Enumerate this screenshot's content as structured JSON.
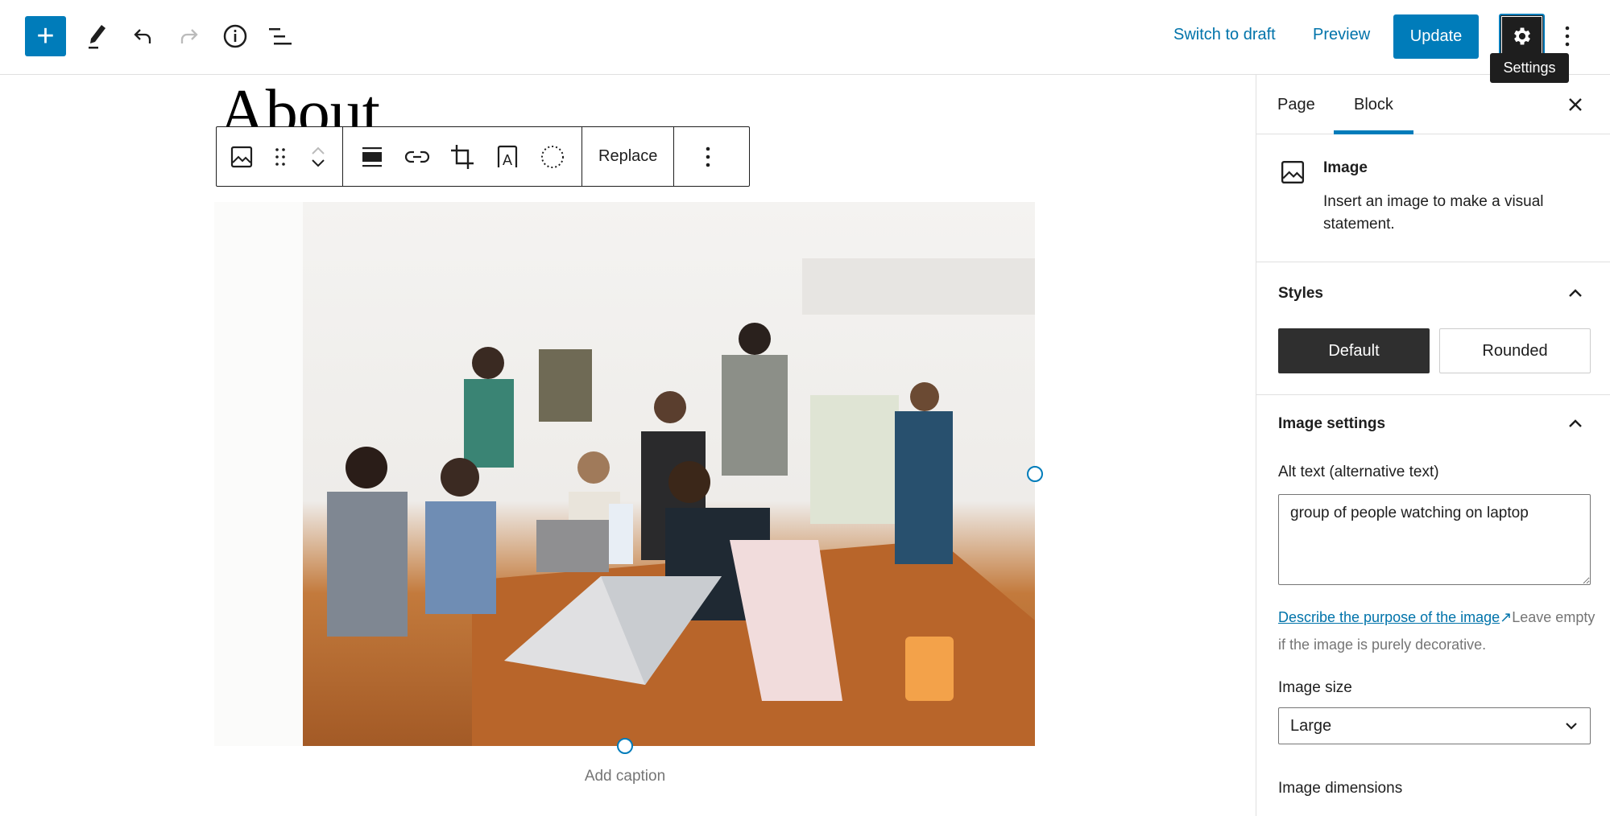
{
  "header": {
    "inserter_icon": "plus-icon",
    "tools": [
      "pencil-icon",
      "undo-icon",
      "redo-icon",
      "info-icon",
      "list-view-icon"
    ],
    "switch_to_draft": "Switch to draft",
    "preview": "Preview",
    "update": "Update",
    "settings_tooltip": "Settings",
    "accent_color": "#007cba"
  },
  "editor": {
    "page_title": "About",
    "block_toolbar": {
      "icons": [
        "image-icon",
        "drag-handle-icon",
        "move-up-icon",
        "move-down-icon",
        "align-icon",
        "link-icon",
        "crop-icon",
        "text-overlay-icon",
        "select-motif-icon",
        "more-options-icon"
      ],
      "replace": "Replace"
    },
    "image_alt": "group of people watching on laptop",
    "caption_placeholder": "Add caption"
  },
  "sidebar": {
    "tabs": [
      {
        "label": "Page",
        "active": false
      },
      {
        "label": "Block",
        "active": true
      }
    ],
    "block": {
      "name": "Image",
      "description": "Insert an image to make a visual statement."
    },
    "styles": {
      "heading": "Styles",
      "options": [
        {
          "label": "Default",
          "active": true
        },
        {
          "label": "Rounded",
          "active": false
        }
      ]
    },
    "image_settings": {
      "heading": "Image settings",
      "alt_label": "Alt text (alternative text)",
      "alt_value": "group of people watching on laptop",
      "help_link": "Describe the purpose of the image",
      "help_text": "Leave empty if the image is purely decorative.",
      "size_label": "Image size",
      "size_value": "Large",
      "dimensions_label": "Image dimensions"
    }
  }
}
